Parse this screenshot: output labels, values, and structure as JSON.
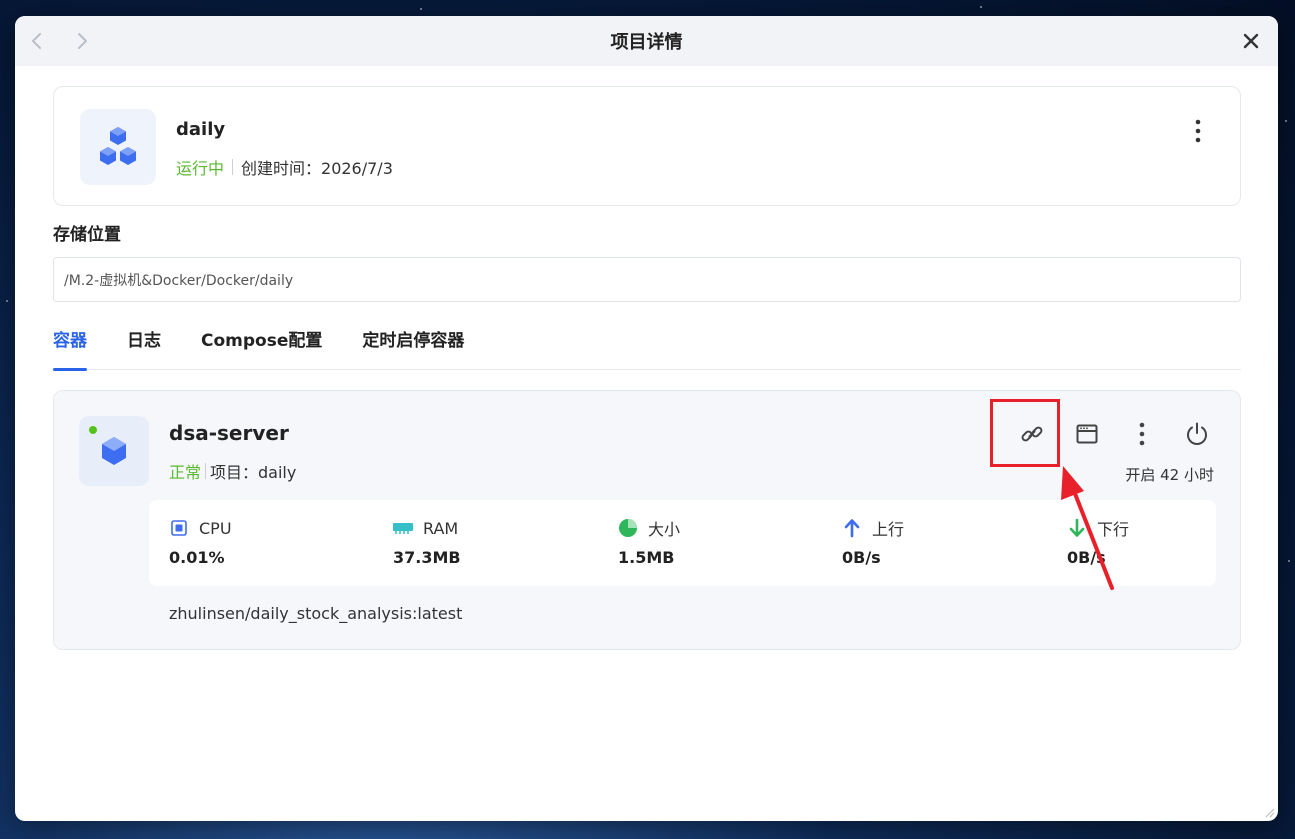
{
  "window": {
    "title": "项目详情"
  },
  "project": {
    "name": "daily",
    "status": "运行中",
    "created": "创建时间：2026/7/3"
  },
  "storage": {
    "label": "存储位置",
    "path": "/M.2-虚拟机&Docker/Docker/daily"
  },
  "tabs": [
    {
      "label": "容器",
      "active": true
    },
    {
      "label": "日志",
      "active": false
    },
    {
      "label": "Compose配置",
      "active": false
    },
    {
      "label": "定时启停容器",
      "active": false
    }
  ],
  "container": {
    "name": "dsa-server",
    "status": "正常",
    "project": "项目：daily",
    "uptime": "开启 42 小时",
    "image": "zhulinsen/daily_stock_analysis:latest",
    "stats": [
      {
        "label": "CPU",
        "value": "0.01%",
        "icon": "cpu-chip-icon"
      },
      {
        "label": "RAM",
        "value": "37.3MB",
        "icon": "memory-module-icon"
      },
      {
        "label": "大小",
        "value": "1.5MB",
        "icon": "pie-chart-icon"
      },
      {
        "label": "上行",
        "value": "0B/s",
        "icon": "arrow-up-icon"
      },
      {
        "label": "下行",
        "value": "0B/s",
        "icon": "arrow-down-icon"
      }
    ]
  },
  "icons": {
    "back": "chevron-left-icon",
    "forward": "chevron-right-icon",
    "close": "close-icon",
    "project": "cubes-icon",
    "container": "cube-icon",
    "link": "link-icon",
    "console": "terminal-window-icon",
    "more": "more-vertical-icon",
    "power": "power-icon"
  },
  "colors": {
    "accent": "#2b63e8",
    "running": "#5bb830",
    "highlight": "#e8202a"
  }
}
